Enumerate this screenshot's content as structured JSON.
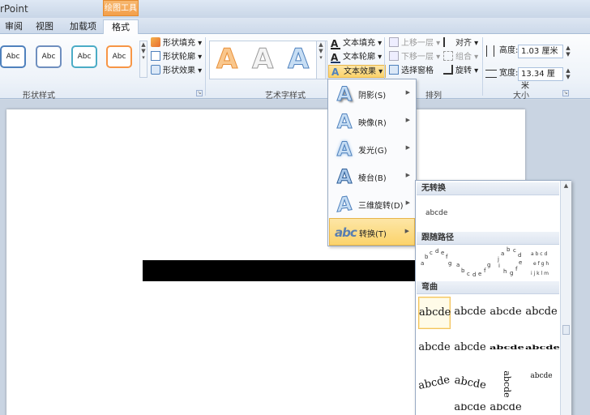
{
  "app": {
    "title": "rPoint",
    "context_group": "绘图工具"
  },
  "tabs": [
    {
      "label": "审阅",
      "active": false
    },
    {
      "label": "视图",
      "active": false
    },
    {
      "label": "加载项",
      "active": false
    },
    {
      "label": "格式",
      "active": true
    }
  ],
  "ribbon": {
    "shape_styles": {
      "label": "形状样式",
      "presets": [
        {
          "text": "Abc",
          "border": "#4f81bd"
        },
        {
          "text": "Abc",
          "border": "#c0504d"
        },
        {
          "text": "Abc",
          "border": "#4bacc6"
        },
        {
          "text": "Abc",
          "border": "#f79646"
        }
      ],
      "commands": [
        "形状填充",
        "形状轮廓",
        "形状效果"
      ]
    },
    "wordart": {
      "label": "艺术字样式",
      "samples": [
        "A",
        "A",
        "A"
      ],
      "commands": [
        "文本填充",
        "文本轮廓",
        "文本效果"
      ]
    },
    "arrange": {
      "label": "排列",
      "commands": [
        "上移一层",
        "下移一层",
        "选择窗格"
      ],
      "right_commands": [
        "对齐",
        "组合",
        "旋转"
      ]
    },
    "size": {
      "label": "大小",
      "height_label": "高度:",
      "height_value": "1.03 厘米",
      "width_label": "宽度:",
      "width_value": "13.34 厘米"
    }
  },
  "text_effects_menu": {
    "items": [
      {
        "label": "阴影(S)",
        "highlighted": false
      },
      {
        "label": "映像(R)",
        "highlighted": false
      },
      {
        "label": "发光(G)",
        "highlighted": false
      },
      {
        "label": "棱台(B)",
        "highlighted": false
      },
      {
        "label": "三维旋转(D)",
        "highlighted": false
      },
      {
        "label": "转换(T)",
        "highlighted": true
      }
    ]
  },
  "transform_submenu": {
    "sections": {
      "no_transform": "无转换",
      "follow_path": "跟随路径",
      "warp": "弯曲"
    },
    "plain_sample": "abcde",
    "warp_sample": "abcde"
  },
  "colors": {
    "accent": "#f39f4a",
    "highlight": "#fbd36b",
    "ribbon_border": "#a9bdd6"
  }
}
